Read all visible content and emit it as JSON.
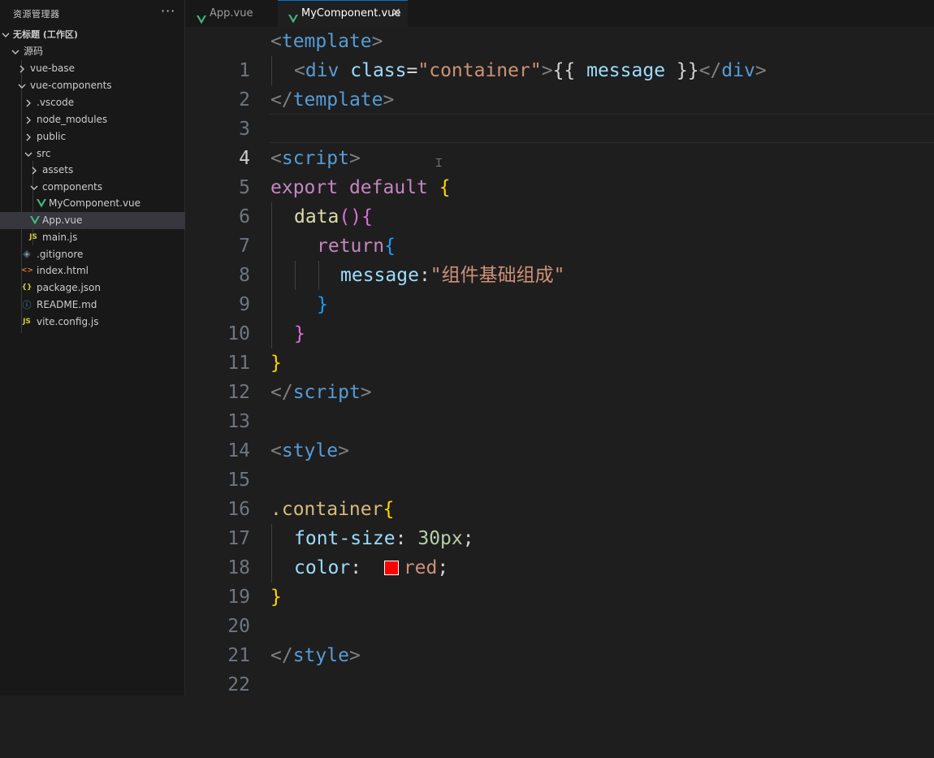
{
  "sidebar": {
    "title": "资源管理器",
    "more": "···",
    "workspace": "无标题 (工作区)",
    "tree": [
      {
        "label": "源码"
      },
      {
        "label": "vue-base"
      },
      {
        "label": "vue-components"
      },
      {
        "label": ".vscode"
      },
      {
        "label": "node_modules"
      },
      {
        "label": "public"
      },
      {
        "label": "src"
      },
      {
        "label": "assets"
      },
      {
        "label": "components"
      },
      {
        "label": "MyComponent.vue"
      },
      {
        "label": "App.vue"
      },
      {
        "label": "main.js"
      },
      {
        "label": ".gitignore"
      },
      {
        "label": "index.html"
      },
      {
        "label": "package.json"
      },
      {
        "label": "README.md"
      },
      {
        "label": "vite.config.js"
      }
    ],
    "icons": {
      "js": "JS",
      "json": "{}",
      "html": "<>",
      "info": "ⓘ"
    }
  },
  "tabs": [
    {
      "label": "App.vue"
    },
    {
      "label": "MyComponent.vue",
      "close": "✕"
    }
  ],
  "editor": {
    "line_numbers": [
      "1",
      "2",
      "3",
      "4",
      "5",
      "6",
      "7",
      "8",
      "9",
      "10",
      "11",
      "12",
      "13",
      "14",
      "15",
      "16",
      "17",
      "18",
      "19",
      "20",
      "21",
      "22"
    ],
    "tokens": {
      "lt": "<",
      "gt": ">",
      "ltslash": "</",
      "template": "template",
      "div": "div",
      "class_attr": "class",
      "eq": "=",
      "container_str": "\"container\"",
      "mustache_open": "{{ ",
      "message": "message",
      "mustache_close": " }}",
      "script": "script",
      "export": "export",
      "default": "default",
      "lbrace": "{",
      "rbrace": "}",
      "data": "data",
      "parens": "()",
      "return": "return",
      "message_key": "message",
      "colon": ":",
      "message_value": "\"组件基础组成\"",
      "style": "style",
      "selector": ".container",
      "prop1": "font-size",
      "value1": "30px",
      "prop2": "color",
      "value2": "red",
      "semi": ";"
    }
  },
  "colors": {
    "accent": "#0078d4",
    "vue": "#41b883",
    "swatch": "#ff0000"
  }
}
